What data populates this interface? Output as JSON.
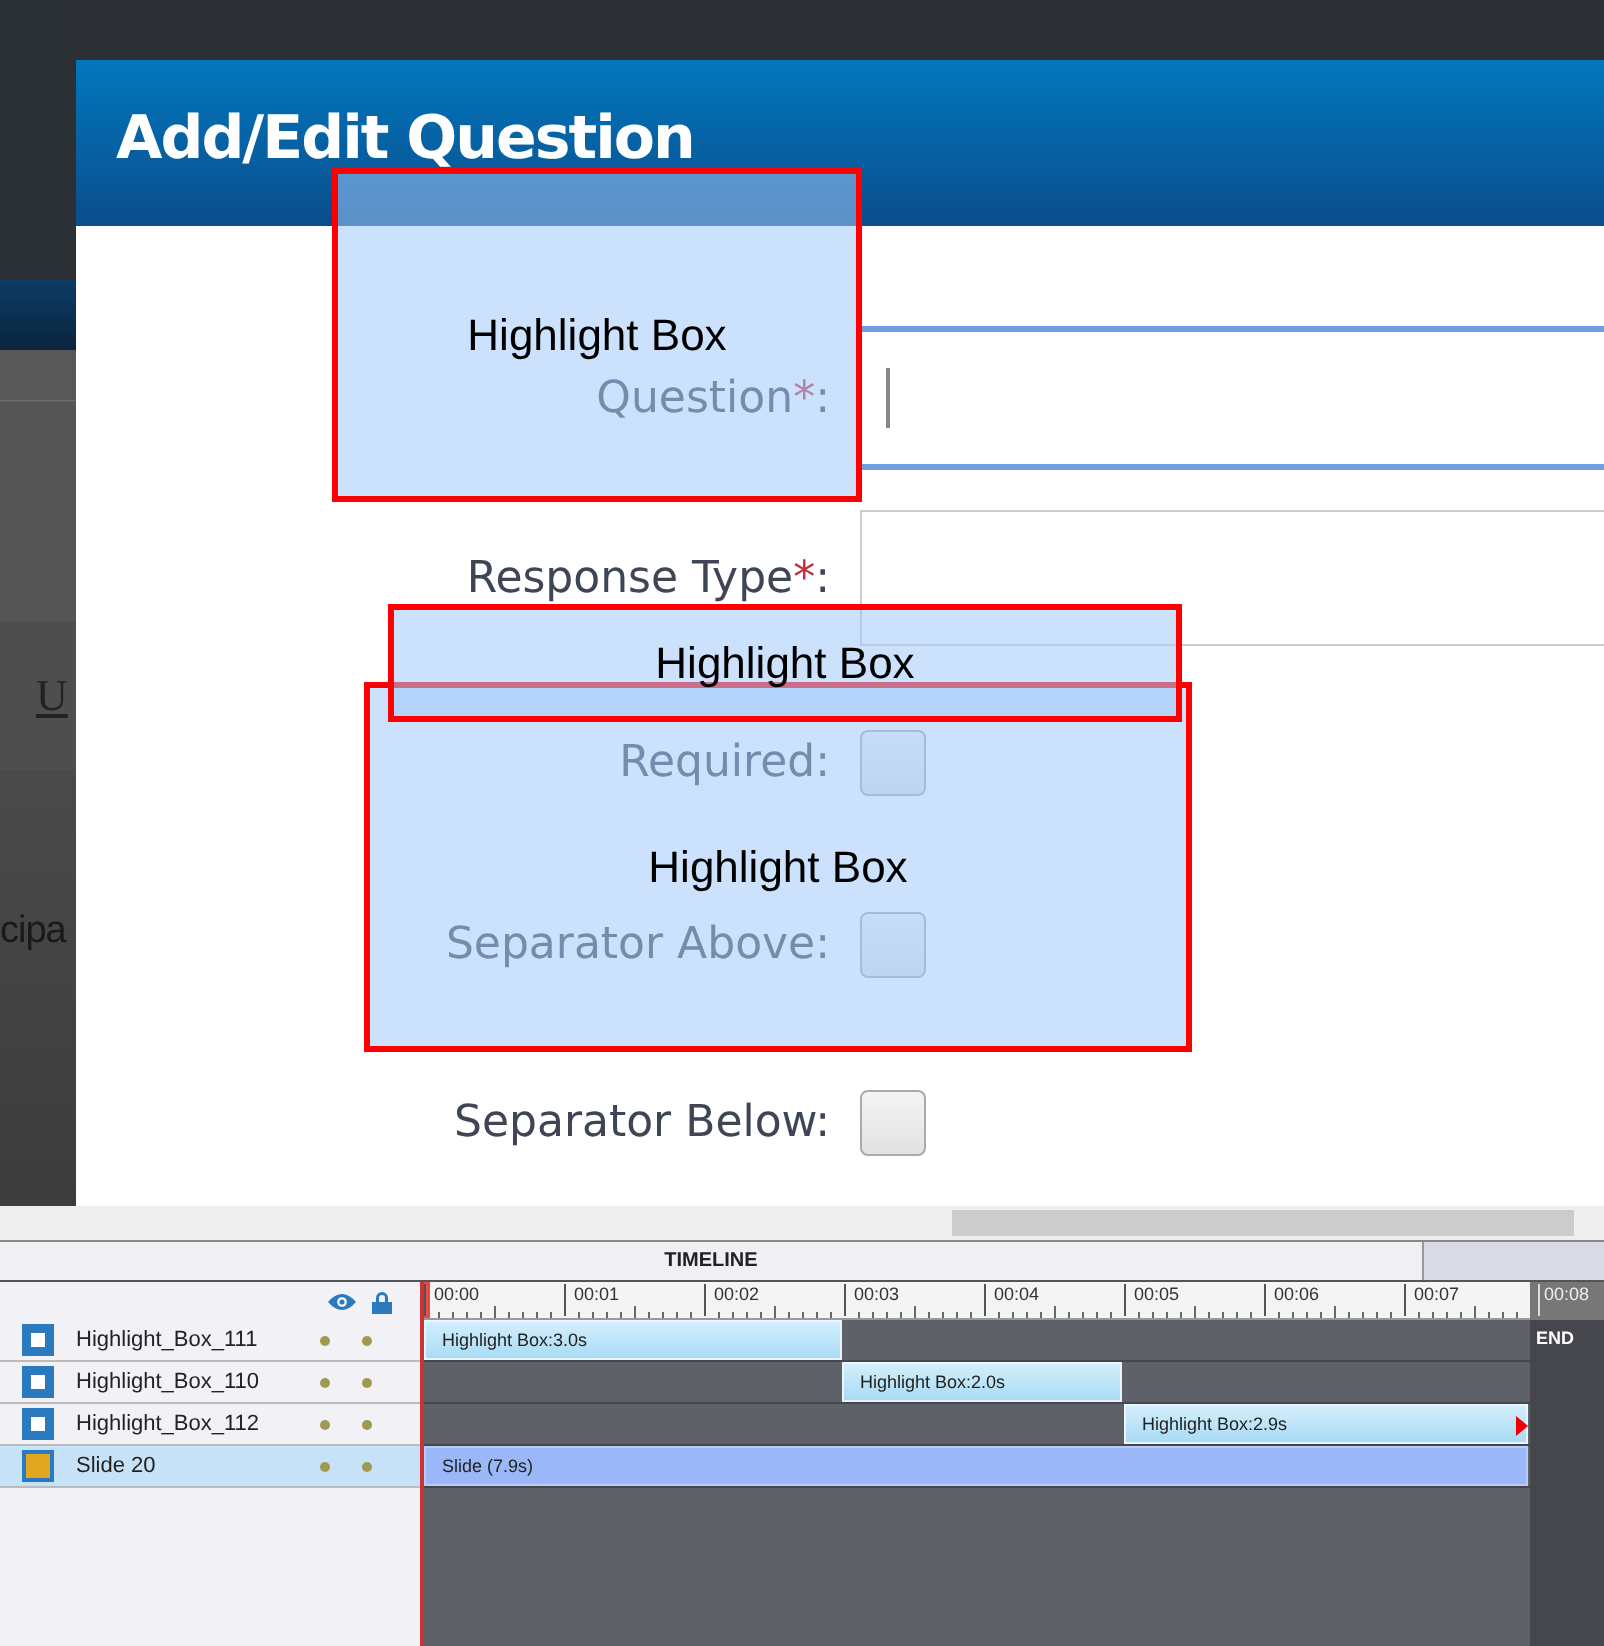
{
  "background_page": {
    "fragments": [
      {
        "text": "U",
        "kind": "link"
      },
      {
        "text": "cipa",
        "kind": "plain"
      }
    ]
  },
  "dialog": {
    "title": "Add/Edit Question",
    "rows": [
      {
        "kind": "text",
        "label": "Question",
        "mark": "*",
        "suffix": ":",
        "focused": true
      },
      {
        "kind": "text",
        "label": "Response Type",
        "mark": "*",
        "suffix": ":",
        "focused": false
      },
      {
        "kind": "checkbox",
        "label": "Required:",
        "checked": false
      },
      {
        "kind": "checkbox",
        "label": "Separator Above:",
        "checked": false
      },
      {
        "kind": "checkbox",
        "label": "Separator Below:",
        "checked": false
      }
    ]
  },
  "highlight_boxes": [
    {
      "caption": "Highlight Box"
    },
    {
      "caption": "Highlight Box"
    },
    {
      "caption": "Highlight Box"
    }
  ],
  "timeline": {
    "title": "TIMELINE",
    "ruler": [
      "00:00",
      "00:01",
      "00:02",
      "00:03",
      "00:04",
      "00:05",
      "00:06",
      "00:07",
      "00:08"
    ],
    "end_label": "END",
    "layers": [
      {
        "name": "Highlight_Box_111",
        "kind": "highlight",
        "selected": false,
        "bar": {
          "label": "Highlight Box:3.0s",
          "end_marker": false
        }
      },
      {
        "name": "Highlight_Box_110",
        "kind": "highlight",
        "selected": false,
        "bar": {
          "label": "Highlight Box:2.0s",
          "end_marker": false
        }
      },
      {
        "name": "Highlight_Box_112",
        "kind": "highlight",
        "selected": false,
        "bar": {
          "label": "Highlight Box:2.9s",
          "end_marker": true
        }
      },
      {
        "name": "Slide 20",
        "kind": "slide",
        "selected": true,
        "bar": {
          "label": "Slide (7.9s)",
          "end_marker": false
        }
      }
    ]
  }
}
